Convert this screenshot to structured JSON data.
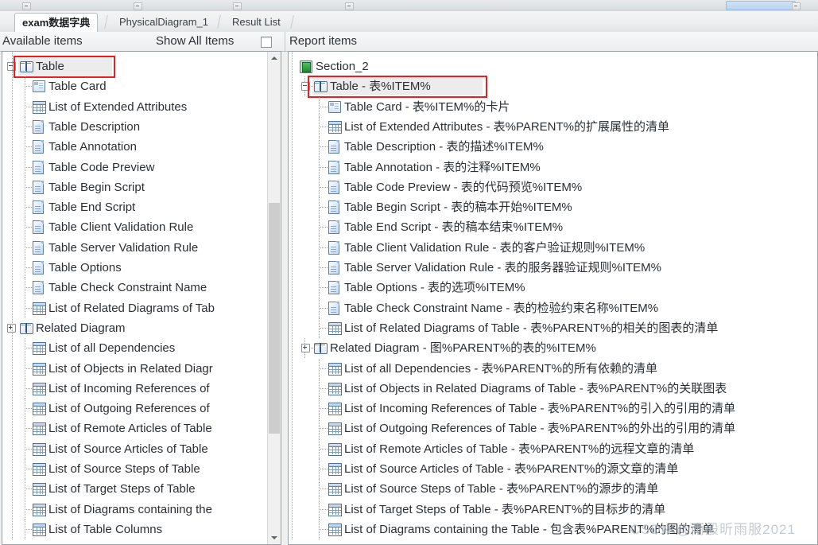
{
  "window": {
    "chrome_ticks": 4
  },
  "tabs": [
    {
      "label": "exam数据字典",
      "active": true
    },
    {
      "label": "PhysicalDiagram_1",
      "active": false
    },
    {
      "label": "Result List",
      "active": false
    }
  ],
  "headers": {
    "available_items": "Available items",
    "show_all_items": "Show All Items",
    "report_items": "Report items"
  },
  "available_items": [
    {
      "label": "Table",
      "icon": "book-icon",
      "depth": 0,
      "expander": "minus",
      "highlight": true
    },
    {
      "label": "Table Card",
      "icon": "card-icon",
      "depth": 1
    },
    {
      "label": "List of Extended Attributes",
      "icon": "grid-icon",
      "depth": 1
    },
    {
      "label": "Table Description",
      "icon": "doc-icon",
      "depth": 1
    },
    {
      "label": "Table Annotation",
      "icon": "doc-icon",
      "depth": 1
    },
    {
      "label": "Table Code Preview",
      "icon": "doc-icon",
      "depth": 1
    },
    {
      "label": "Table Begin Script",
      "icon": "doc-icon",
      "depth": 1
    },
    {
      "label": "Table End Script",
      "icon": "doc-icon",
      "depth": 1
    },
    {
      "label": "Table Client Validation Rule",
      "icon": "doc-icon",
      "depth": 1
    },
    {
      "label": "Table Server Validation Rule",
      "icon": "doc-icon",
      "depth": 1
    },
    {
      "label": "Table Options",
      "icon": "doc-icon",
      "depth": 1
    },
    {
      "label": "Table Check Constraint Name",
      "icon": "doc-icon",
      "depth": 1
    },
    {
      "label": "List of Related Diagrams of Tab",
      "icon": "grid-icon",
      "depth": 1
    },
    {
      "label": "Related Diagram",
      "icon": "book-icon",
      "depth": 0,
      "expander": "plus"
    },
    {
      "label": "List of all Dependencies",
      "icon": "grid-icon",
      "depth": 1
    },
    {
      "label": "List of Objects in Related Diagr",
      "icon": "grid-icon",
      "depth": 1
    },
    {
      "label": "List of Incoming References of",
      "icon": "grid-icon",
      "depth": 1
    },
    {
      "label": "List of Outgoing References of",
      "icon": "grid-icon",
      "depth": 1
    },
    {
      "label": "List of Remote Articles of Table",
      "icon": "grid-icon",
      "depth": 1
    },
    {
      "label": "List of Source Articles of Table",
      "icon": "grid-icon",
      "depth": 1
    },
    {
      "label": "List of Source Steps of Table",
      "icon": "grid-icon",
      "depth": 1
    },
    {
      "label": "List of Target Steps of Table",
      "icon": "grid-icon",
      "depth": 1
    },
    {
      "label": "List of Diagrams containing the",
      "icon": "grid-icon",
      "depth": 1
    },
    {
      "label": "List of Table Columns",
      "icon": "grid-icon",
      "depth": 1
    }
  ],
  "report_items": [
    {
      "label": "Section_2",
      "icon": "section-icon",
      "depth": 0
    },
    {
      "label": "Table - 表%ITEM%",
      "icon": "book-icon",
      "depth": 1,
      "expander": "minus",
      "highlight": true
    },
    {
      "label": "Table Card - 表%ITEM%的卡片",
      "icon": "card-icon",
      "depth": 2
    },
    {
      "label": "List of Extended Attributes - 表%PARENT%的扩展属性的清单",
      "icon": "grid-icon",
      "depth": 2
    },
    {
      "label": "Table Description - 表的描述%ITEM%",
      "icon": "doc-icon",
      "depth": 2
    },
    {
      "label": "Table Annotation - 表的注释%ITEM%",
      "icon": "doc-icon",
      "depth": 2
    },
    {
      "label": "Table Code Preview - 表的代码预览%ITEM%",
      "icon": "doc-icon",
      "depth": 2
    },
    {
      "label": "Table Begin Script - 表的稿本开始%ITEM%",
      "icon": "doc-icon",
      "depth": 2
    },
    {
      "label": "Table End Script - 表的稿本结束%ITEM%",
      "icon": "doc-icon",
      "depth": 2
    },
    {
      "label": "Table Client Validation Rule - 表的客户验证规则%ITEM%",
      "icon": "doc-icon",
      "depth": 2
    },
    {
      "label": "Table Server Validation Rule - 表的服务器验证规则%ITEM%",
      "icon": "doc-icon",
      "depth": 2
    },
    {
      "label": "Table Options - 表的选项%ITEM%",
      "icon": "doc-icon",
      "depth": 2
    },
    {
      "label": "Table Check Constraint Name - 表的检验约束名称%ITEM%",
      "icon": "doc-icon",
      "depth": 2
    },
    {
      "label": "List of Related Diagrams of Table - 表%PARENT%的相关的图表的清单",
      "icon": "grid-icon",
      "depth": 2
    },
    {
      "label": "Related Diagram - 图%PARENT%的表的%ITEM%",
      "icon": "book-icon",
      "depth": 1,
      "expander": "plus"
    },
    {
      "label": "List of all Dependencies - 表%PARENT%的所有依赖的清单",
      "icon": "grid-icon",
      "depth": 2
    },
    {
      "label": "List of Objects in Related Diagrams of Table - 表%PARENT%的关联图表",
      "icon": "grid-icon",
      "depth": 2
    },
    {
      "label": "List of Incoming References of Table - 表%PARENT%的引入的引用的清单",
      "icon": "grid-icon",
      "depth": 2
    },
    {
      "label": "List of Outgoing References of Table - 表%PARENT%的外出的引用的清单",
      "icon": "grid-icon",
      "depth": 2
    },
    {
      "label": "List of Remote Articles of Table - 表%PARENT%的远程文章的清单",
      "icon": "grid-icon",
      "depth": 2
    },
    {
      "label": "List of Source Articles of Table - 表%PARENT%的源文章的清单",
      "icon": "grid-icon",
      "depth": 2
    },
    {
      "label": "List of Source Steps of Table - 表%PARENT%的源步的清单",
      "icon": "grid-icon",
      "depth": 2
    },
    {
      "label": "List of Target Steps of Table - 表%PARENT%的目标步的清单",
      "icon": "grid-icon",
      "depth": 2
    },
    {
      "label": "List of Diagrams containing the Table - 包含表%PARENT%的图的清单",
      "icon": "grid-icon",
      "depth": 2
    }
  ],
  "watermark": "CSDN @雨般昕雨服2021",
  "colors": {
    "highlight_red": "#ee1c1c",
    "section_green": "#1f8a34",
    "icon_blue": "#4d6f9b",
    "text": "#2b2f33"
  }
}
